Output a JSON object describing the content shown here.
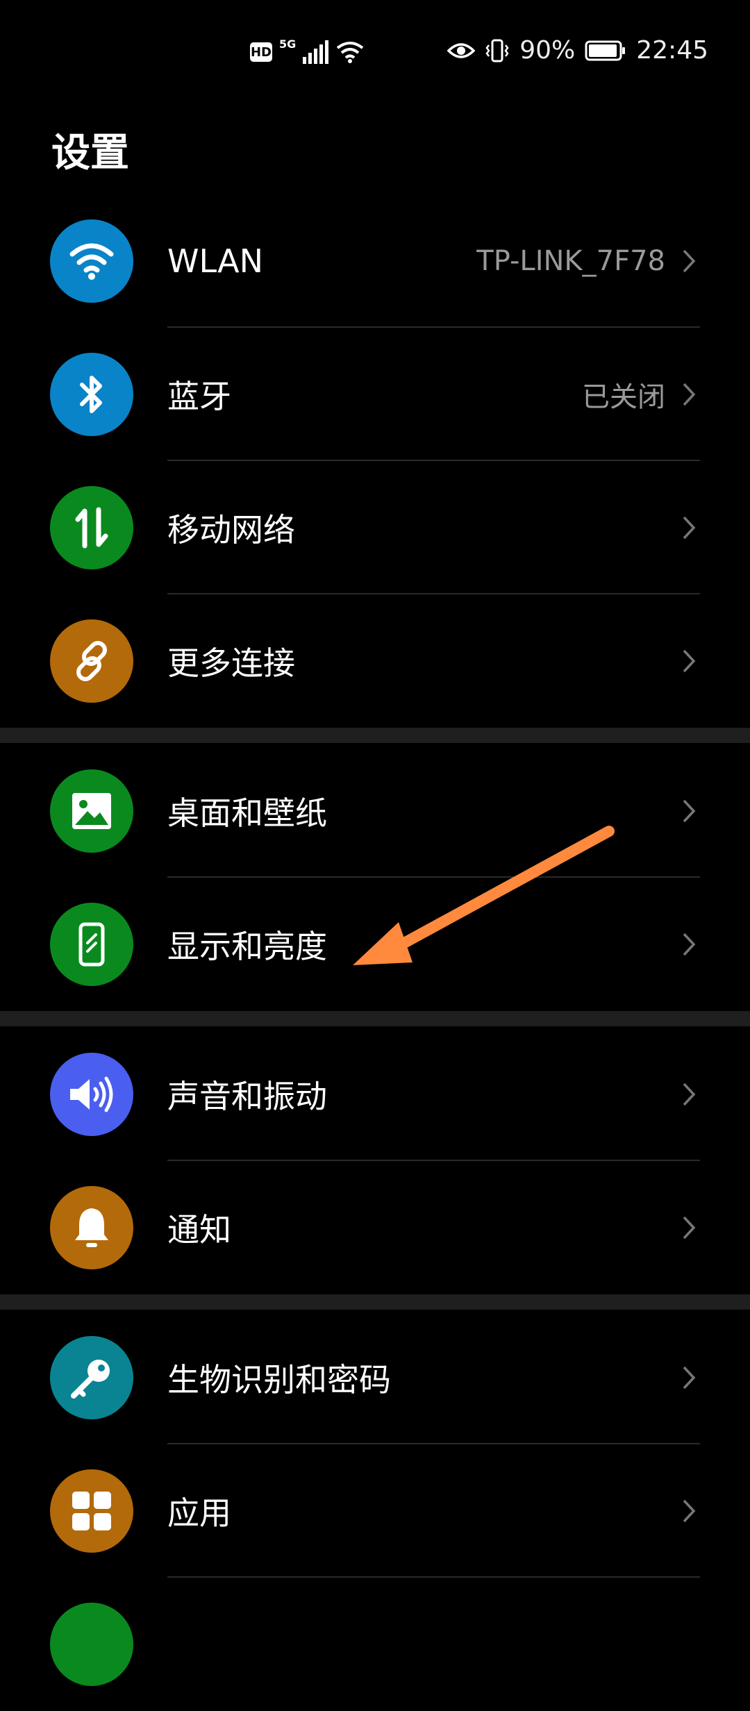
{
  "status_bar": {
    "hd": "HD",
    "network": "5G",
    "battery": "90%",
    "time": "22:45"
  },
  "title": "设置",
  "groups": [
    [
      {
        "label": "WLAN",
        "value": "TP-LINK_7F78",
        "icon": "wifi-icon",
        "color": "#0a84c8"
      },
      {
        "label": "蓝牙",
        "value": "已关闭",
        "icon": "bluetooth-icon",
        "color": "#0a84c8"
      },
      {
        "label": "移动网络",
        "value": "",
        "icon": "mobile-data-icon",
        "color": "#0a8a1e"
      },
      {
        "label": "更多连接",
        "value": "",
        "icon": "link-icon",
        "color": "#b36a0b"
      }
    ],
    [
      {
        "label": "桌面和壁纸",
        "value": "",
        "icon": "image-icon",
        "color": "#0a8a1e"
      },
      {
        "label": "显示和亮度",
        "value": "",
        "icon": "phone-display-icon",
        "color": "#0a8a1e"
      }
    ],
    [
      {
        "label": "声音和振动",
        "value": "",
        "icon": "speaker-icon",
        "color": "#4a5ef0"
      },
      {
        "label": "通知",
        "value": "",
        "icon": "bell-icon",
        "color": "#b36a0b"
      }
    ],
    [
      {
        "label": "生物识别和密码",
        "value": "",
        "icon": "key-icon",
        "color": "#0a8493"
      },
      {
        "label": "应用",
        "value": "",
        "icon": "apps-grid-icon",
        "color": "#b36a0b"
      }
    ]
  ],
  "annotation": {
    "color": "#ff8a3d",
    "target": "显示和亮度"
  }
}
